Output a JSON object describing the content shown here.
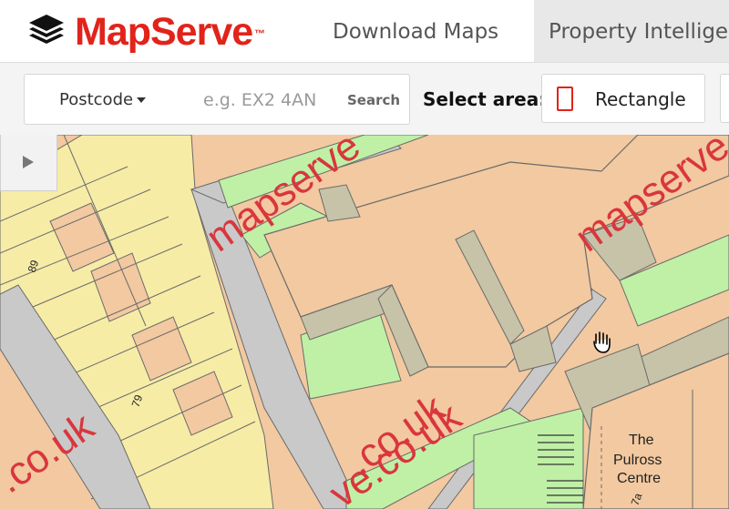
{
  "brand": {
    "name": "MapServe",
    "tm": "™"
  },
  "nav": {
    "download_maps": "Download Maps",
    "property_intelligence": "Property Intellige"
  },
  "search": {
    "type_label": "Postcode",
    "placeholder": "e.g. EX2 4AN",
    "button": "Search"
  },
  "area": {
    "label": "Select area:",
    "rectangle": "Rectangle"
  },
  "map": {
    "labels": {
      "house_89": "89",
      "house_79": "79",
      "building_line1": "The",
      "building_line2": "Pulross",
      "building_line3": "Centre",
      "partial_number": "7a"
    },
    "watermark": [
      "mapserve",
      "mapserve",
      ".co.uk",
      "ve.co.uk",
      ".co.uk"
    ]
  },
  "colors": {
    "accent": "#e2231a",
    "map_building": "#f2c9a0",
    "map_house": "#f6eca6",
    "map_green": "#bff0a6",
    "map_road": "#c9c9c9",
    "map_path": "#c7c3a8"
  },
  "icons": {
    "logo": "stacked-layers-icon",
    "caret": "caret-down-icon",
    "rectangle": "rectangle-icon",
    "panel": "expand-panel-icon",
    "cursor": "hand-cursor-icon"
  }
}
